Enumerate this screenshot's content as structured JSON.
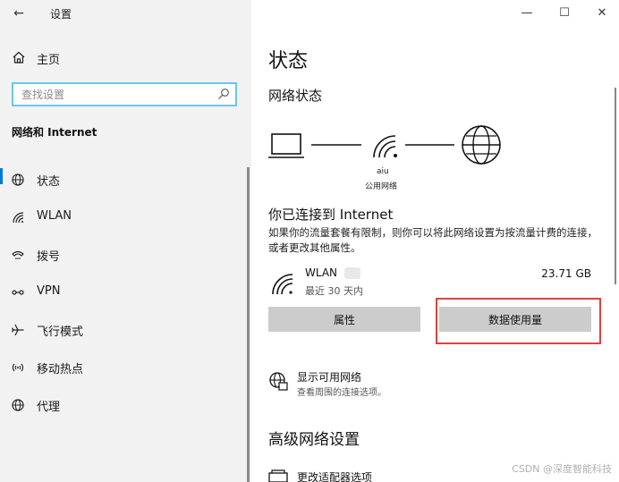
{
  "window": {
    "title": "设置",
    "controls": {
      "minimize": "—",
      "maximize": "☐",
      "close": "✕"
    }
  },
  "sidebar": {
    "back_icon": "arrow-left-icon",
    "home_label": "主页",
    "search_placeholder": "查找设置",
    "section": "网络和 Internet",
    "items": [
      {
        "label": "状态",
        "icon": "status-globe-icon",
        "active": true
      },
      {
        "label": "WLAN",
        "icon": "wifi-icon",
        "active": false
      },
      {
        "label": "拨号",
        "icon": "dialup-icon",
        "active": false
      },
      {
        "label": "VPN",
        "icon": "vpn-icon",
        "active": false
      },
      {
        "label": "飞行模式",
        "icon": "airplane-icon",
        "active": false
      },
      {
        "label": "移动热点",
        "icon": "hotspot-icon",
        "active": false
      },
      {
        "label": "代理",
        "icon": "globe-icon",
        "active": false
      }
    ]
  },
  "main": {
    "title": "状态",
    "network_status_heading": "网络状态",
    "diagram": {
      "ssid": "aiu",
      "network_type": "公用网络"
    },
    "connected_heading": "你已连接到 Internet",
    "description": "如果你的流量套餐有限制，则你可以将此网络设置为按流量计费的连接，或者更改其他属性。",
    "connection": {
      "name": "WLAN",
      "period": "最近 30 天内",
      "usage": "23.71 GB"
    },
    "buttons": {
      "properties": "属性",
      "data_usage": "数据使用量"
    },
    "highlight_color": "#e0413d",
    "available": {
      "title": "显示可用网络",
      "subtitle": "查看周围的连接选项。"
    },
    "advanced_heading": "高级网络设置",
    "adapter_label": "更改适配器选项"
  },
  "watermark": "CSDN @深度智能科技"
}
